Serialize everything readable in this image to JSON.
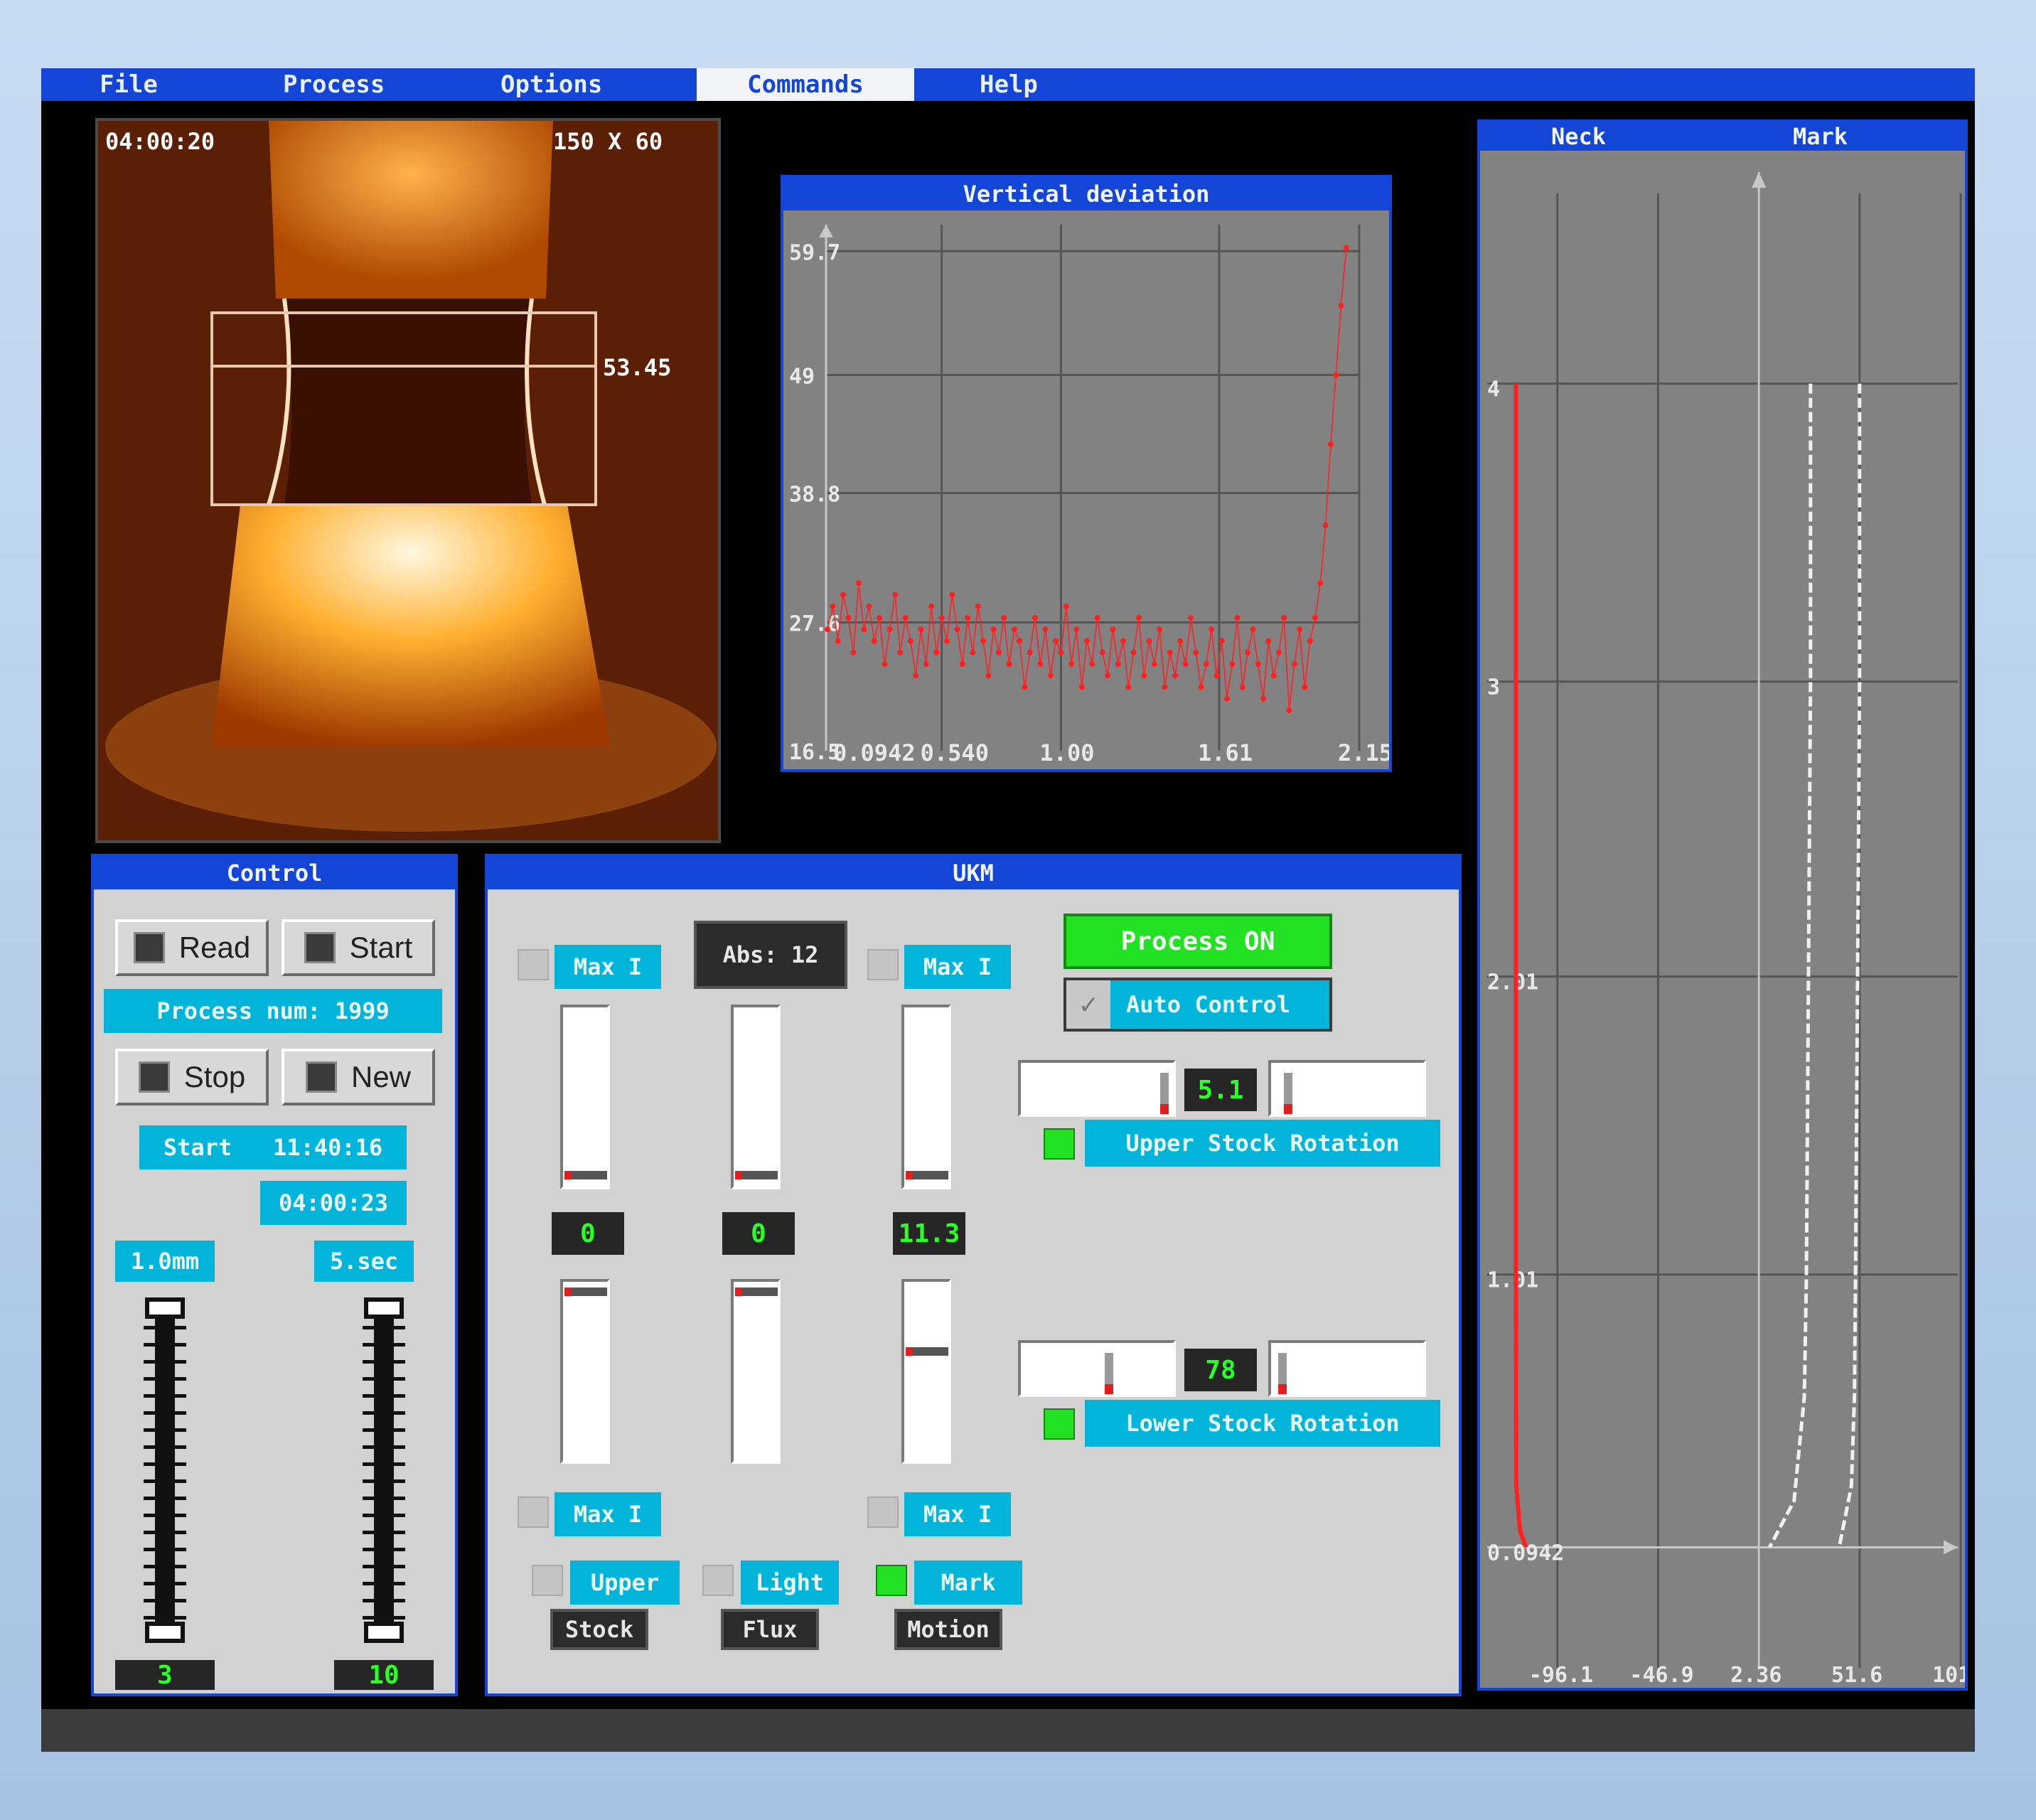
{
  "menu": {
    "file": "File",
    "process": "Process",
    "options": "Options",
    "commands": "Commands",
    "help": "Help"
  },
  "camera": {
    "time": "04:00:20",
    "resolution": "150 X 60",
    "measurement": "53.45"
  },
  "vertical_deviation": {
    "title": "Vertical deviation"
  },
  "necks_panel": {
    "left_title": "Neck",
    "right_title": "Mark"
  },
  "chart_data": [
    {
      "type": "scatter",
      "title": "Vertical deviation",
      "xlabel": "",
      "ylabel": "",
      "x_ticks": [
        "0.0942",
        "0.540",
        "1.00",
        "1.61",
        "2.15"
      ],
      "y_ticks": [
        "16.5",
        "27.6",
        "38.8",
        "49",
        "59.7"
      ],
      "xlim": [
        0.0942,
        2.15
      ],
      "ylim": [
        16.5,
        62
      ],
      "series": [
        {
          "color": "#ff2020",
          "x": [
            0.1,
            0.12,
            0.14,
            0.16,
            0.18,
            0.2,
            0.22,
            0.24,
            0.26,
            0.28,
            0.3,
            0.32,
            0.34,
            0.36,
            0.38,
            0.4,
            0.42,
            0.44,
            0.46,
            0.48,
            0.5,
            0.52,
            0.54,
            0.56,
            0.58,
            0.6,
            0.62,
            0.64,
            0.66,
            0.68,
            0.7,
            0.72,
            0.74,
            0.76,
            0.78,
            0.8,
            0.82,
            0.84,
            0.86,
            0.88,
            0.9,
            0.92,
            0.94,
            0.96,
            0.98,
            1.0,
            1.02,
            1.04,
            1.06,
            1.08,
            1.1,
            1.12,
            1.14,
            1.16,
            1.18,
            1.2,
            1.22,
            1.24,
            1.26,
            1.28,
            1.3,
            1.32,
            1.34,
            1.36,
            1.38,
            1.4,
            1.42,
            1.44,
            1.46,
            1.48,
            1.5,
            1.52,
            1.54,
            1.56,
            1.58,
            1.6,
            1.62,
            1.64,
            1.66,
            1.68,
            1.7,
            1.72,
            1.74,
            1.76,
            1.78,
            1.8,
            1.82,
            1.84,
            1.86,
            1.88,
            1.9,
            1.92,
            1.94,
            1.96,
            1.98,
            2.0,
            2.02,
            2.04,
            2.06,
            2.08,
            2.1
          ],
          "y": [
            27,
            29,
            26,
            30,
            28,
            25,
            31,
            27,
            29,
            26,
            28,
            24,
            27,
            30,
            25,
            28,
            26,
            23,
            27,
            24,
            29,
            25,
            28,
            26,
            30,
            27,
            24,
            28,
            25,
            29,
            26,
            23,
            27,
            25,
            28,
            24,
            27,
            26,
            22,
            25,
            28,
            24,
            27,
            23,
            26,
            25,
            29,
            24,
            27,
            22,
            26,
            24,
            28,
            25,
            23,
            27,
            24,
            26,
            22,
            25,
            28,
            23,
            26,
            24,
            27,
            22,
            25,
            23,
            26,
            24,
            28,
            25,
            22,
            24,
            27,
            23,
            26,
            21,
            24,
            28,
            22,
            25,
            27,
            24,
            21,
            26,
            23,
            25,
            28,
            20,
            24,
            27,
            22,
            26,
            28,
            31,
            36,
            43,
            49,
            55,
            60
          ]
        }
      ]
    },
    {
      "type": "line",
      "title": "",
      "x_ticks": [
        "-96.1",
        "-46.9",
        "2.36",
        "51.6",
        "101"
      ],
      "y_ticks": [
        "0.0942",
        "1.01",
        "2.01",
        "3",
        "4"
      ],
      "xlim": [
        -120,
        110
      ],
      "ylim": [
        0,
        4.4
      ],
      "series": [
        {
          "name": "Neck",
          "color": "#ff2020",
          "points": [
            [
              -106,
              4
            ],
            [
              -106,
              3
            ],
            [
              -106,
              2
            ],
            [
              -106,
              1
            ],
            [
              -105.8,
              0.3
            ],
            [
              -104,
              0.15
            ],
            [
              -101,
              0.0942
            ]
          ]
        },
        {
          "name": "Mark",
          "color": "#f0f0f0",
          "points": [
            [
              38,
              4
            ],
            [
              38,
              3
            ],
            [
              37,
              2
            ],
            [
              36,
              1
            ],
            [
              35,
              0.6
            ],
            [
              30,
              0.25
            ],
            [
              18,
              0.0942
            ]
          ]
        },
        {
          "name": "Mark",
          "color": "#f0f0f0",
          "points": [
            [
              62,
              4
            ],
            [
              62,
              3
            ],
            [
              61,
              2
            ],
            [
              60,
              1
            ],
            [
              59.5,
              0.6
            ],
            [
              58,
              0.3
            ],
            [
              52,
              0.0942
            ]
          ]
        }
      ]
    }
  ],
  "control": {
    "title": "Control",
    "read": "Read",
    "start": "Start",
    "process_num": "Process num: 1999",
    "stop": "Stop",
    "new": "New",
    "start_time": "Start   11:40:16",
    "elapsed": "04:00:23",
    "left_label": "1.0mm",
    "right_label": "5.sec",
    "left_value": "3",
    "right_value": "10"
  },
  "ukm": {
    "title": "UKM",
    "max1": "Max I",
    "abs": "Abs: 12",
    "max2": "Max I",
    "v1": "0",
    "v2": "0",
    "v3": "11.3",
    "max3": "Max I",
    "max4": "Max I",
    "upper": "Upper",
    "stock": "Stock",
    "light": "Light",
    "flux": "Flux",
    "mark": "Mark",
    "motion": "Motion",
    "process_on": "Process ON",
    "auto_control": "Auto Control",
    "upper_speed": "5.1",
    "upper_rotation": "Upper Stock Rotation",
    "lower_speed": "78",
    "lower_rotation": "Lower Stock Rotation"
  },
  "colors": {
    "titlebar": "#1346d6",
    "accent": "#00b5d9",
    "led": "#22e022",
    "plot_bg": "#828282"
  }
}
